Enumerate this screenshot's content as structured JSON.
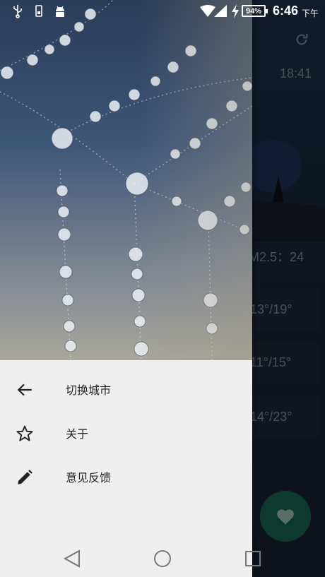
{
  "status_bar": {
    "battery_percent": "94%",
    "time": "6:46",
    "ampm": "下午",
    "icons": [
      "usb-icon",
      "phone-storage-icon",
      "android-icon",
      "wifi-icon",
      "cellular-signal-icon",
      "charging-bolt-icon",
      "battery-icon"
    ]
  },
  "background_app": {
    "update_time": "18:41",
    "aqi_text": "M2.5：24",
    "forecast": [
      "13°/19°",
      "11°/15°",
      "14°/23°"
    ],
    "icons": [
      "refresh-icon",
      "heart-icon"
    ],
    "fab_color": "#155a48"
  },
  "drawer": {
    "menu": [
      {
        "label": "切换城市",
        "icon": "arrow-back-icon"
      },
      {
        "label": "关于",
        "icon": "star-outline-icon"
      },
      {
        "label": "意见反馈",
        "icon": "pencil-icon"
      }
    ]
  },
  "nav_bar": {
    "icons": [
      "back-triangle-icon",
      "home-circle-icon",
      "recents-square-icon"
    ]
  }
}
